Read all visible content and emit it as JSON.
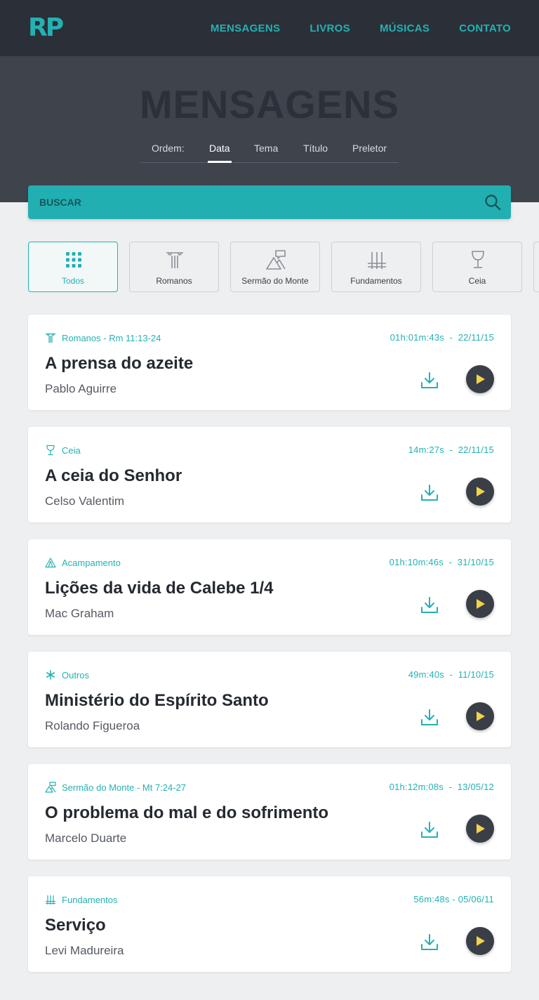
{
  "brand": {
    "logo_text": "RP",
    "accent": "#24b1b3",
    "dark": "#2b2f37",
    "play_color": "#f2d34a"
  },
  "nav": {
    "items": [
      "MENSAGENS",
      "LIVROS",
      "MÚSICAS",
      "CONTATO"
    ]
  },
  "hero": {
    "title": "MENSAGENS",
    "order_label": "Ordem:",
    "order_options": [
      "Data",
      "Tema",
      "Título",
      "Preletor"
    ],
    "order_active": "Data"
  },
  "search": {
    "placeholder": "BUSCAR"
  },
  "filters": [
    {
      "label": "Todos",
      "icon": "grid-icon",
      "active": true
    },
    {
      "label": "Romanos",
      "icon": "column-icon",
      "active": false
    },
    {
      "label": "Sermão do Monte",
      "icon": "mountain-speech-icon",
      "active": false
    },
    {
      "label": "Fundamentos",
      "icon": "foundation-icon",
      "active": false
    },
    {
      "label": "Ceia",
      "icon": "chalice-icon",
      "active": false
    }
  ],
  "messages": [
    {
      "category": "Romanos - Rm 11:13-24",
      "icon": "column-icon",
      "duration": "01h:01m:43s",
      "date": "22/11/15",
      "title": "A prensa do azeite",
      "speaker": "Pablo Aguirre"
    },
    {
      "category": "Ceia",
      "icon": "chalice-icon",
      "duration": "14m:27s",
      "date": "22/11/15",
      "title": "A ceia do Senhor",
      "speaker": "Celso Valentim"
    },
    {
      "category": "Acampamento",
      "icon": "tent-icon",
      "duration": "01h:10m:46s",
      "date": "31/10/15",
      "title": "Lições da vida de Calebe 1/4",
      "speaker": "Mac Graham"
    },
    {
      "category": "Outros",
      "icon": "asterisk-icon",
      "duration": "49m:40s",
      "date": "11/10/15",
      "title": "Ministério do Espírito Santo",
      "speaker": "Rolando Figueroa"
    },
    {
      "category": "Sermão do Monte - Mt 7:24-27",
      "icon": "mountain-speech-icon",
      "duration": "01h:12m:08s",
      "date": "13/05/12",
      "title": "O problema do mal e do sofrimento",
      "speaker": "Marcelo Duarte"
    },
    {
      "category": "Fundamentos",
      "icon": "foundation-icon",
      "duration": "56m:48s",
      "date": "05/06/11",
      "title": "Serviço",
      "speaker": "Levi Madureira"
    }
  ]
}
